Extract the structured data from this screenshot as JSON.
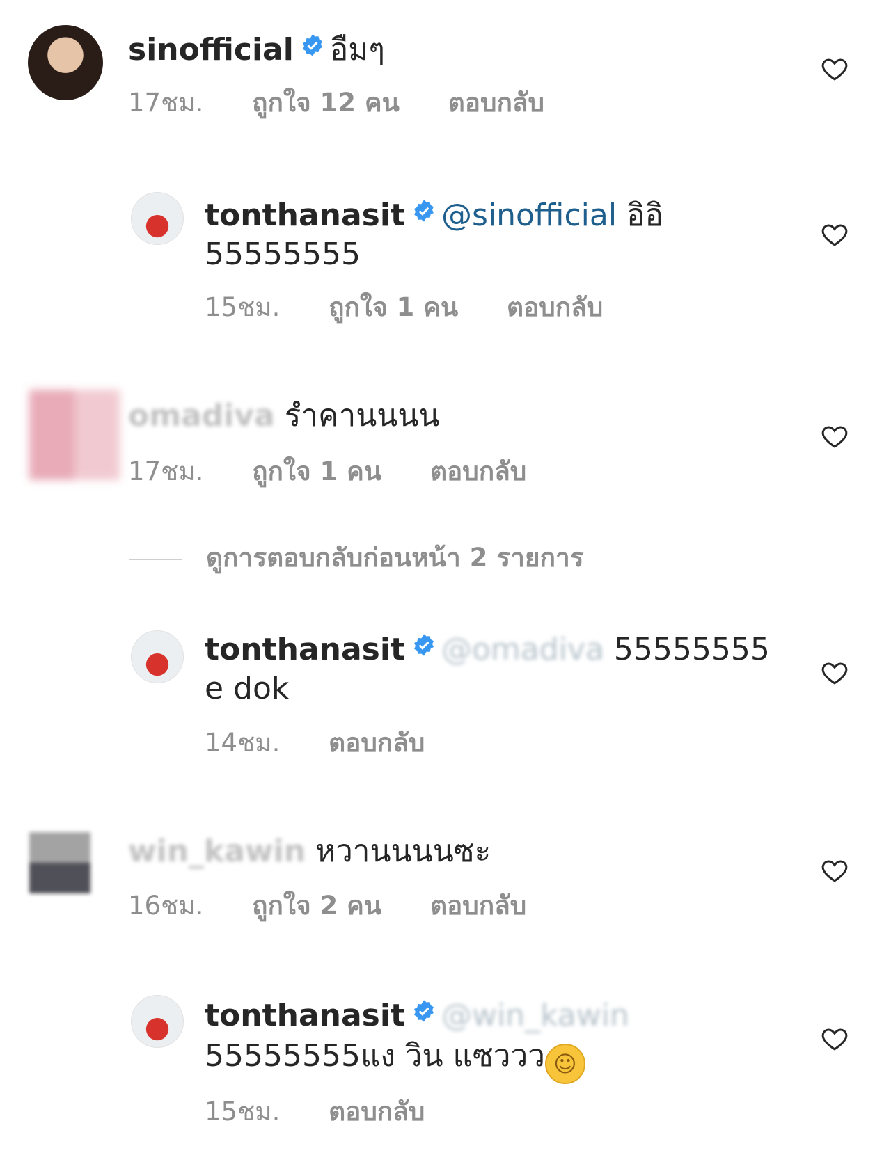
{
  "comments": [
    {
      "username": "sinofficial",
      "verified": true,
      "text": "อืมๆ",
      "time": "17ชม.",
      "likes": "ถูกใจ 12 คน",
      "reply": "ตอบกลับ"
    },
    {
      "username": "tonthanasit",
      "verified": true,
      "mention": "@sinofficial",
      "text_inline": "อิอิ",
      "text_line2": "55555555",
      "time": "15ชม.",
      "likes": "ถูกใจ 1 คน",
      "reply": "ตอบกลับ"
    },
    {
      "username": "omadiva",
      "text": "รำคานนนน",
      "time": "17ชม.",
      "likes": "ถูกใจ 1 คน",
      "reply": "ตอบกลับ"
    },
    {
      "username": "tonthanasit",
      "verified": true,
      "mention": "@omadiva",
      "text_inline": "55555555",
      "text_line2": "e dok",
      "time": "14ชม.",
      "reply": "ตอบกลับ"
    },
    {
      "username": "win_kawin",
      "text": "หวานนนนซะ",
      "time": "16ชม.",
      "likes": "ถูกใจ 2 คน",
      "reply": "ตอบกลับ"
    },
    {
      "username": "tonthanasit",
      "verified": true,
      "mention": "@win_kawin",
      "text_line2": "55555555แง วิน แซววว",
      "emoji": "☺",
      "time": "15ชม.",
      "reply": "ตอบกลับ"
    }
  ],
  "view_previous_replies": "ดูการตอบกลับก่อนหน้า 2 รายการ",
  "colors": {
    "verified_badge": "#3897f0",
    "mention": "#1f5f8e",
    "meta_text": "#8e8e8e"
  },
  "icons": {
    "like": "heart-outline-icon",
    "verified": "verified-badge-icon"
  }
}
